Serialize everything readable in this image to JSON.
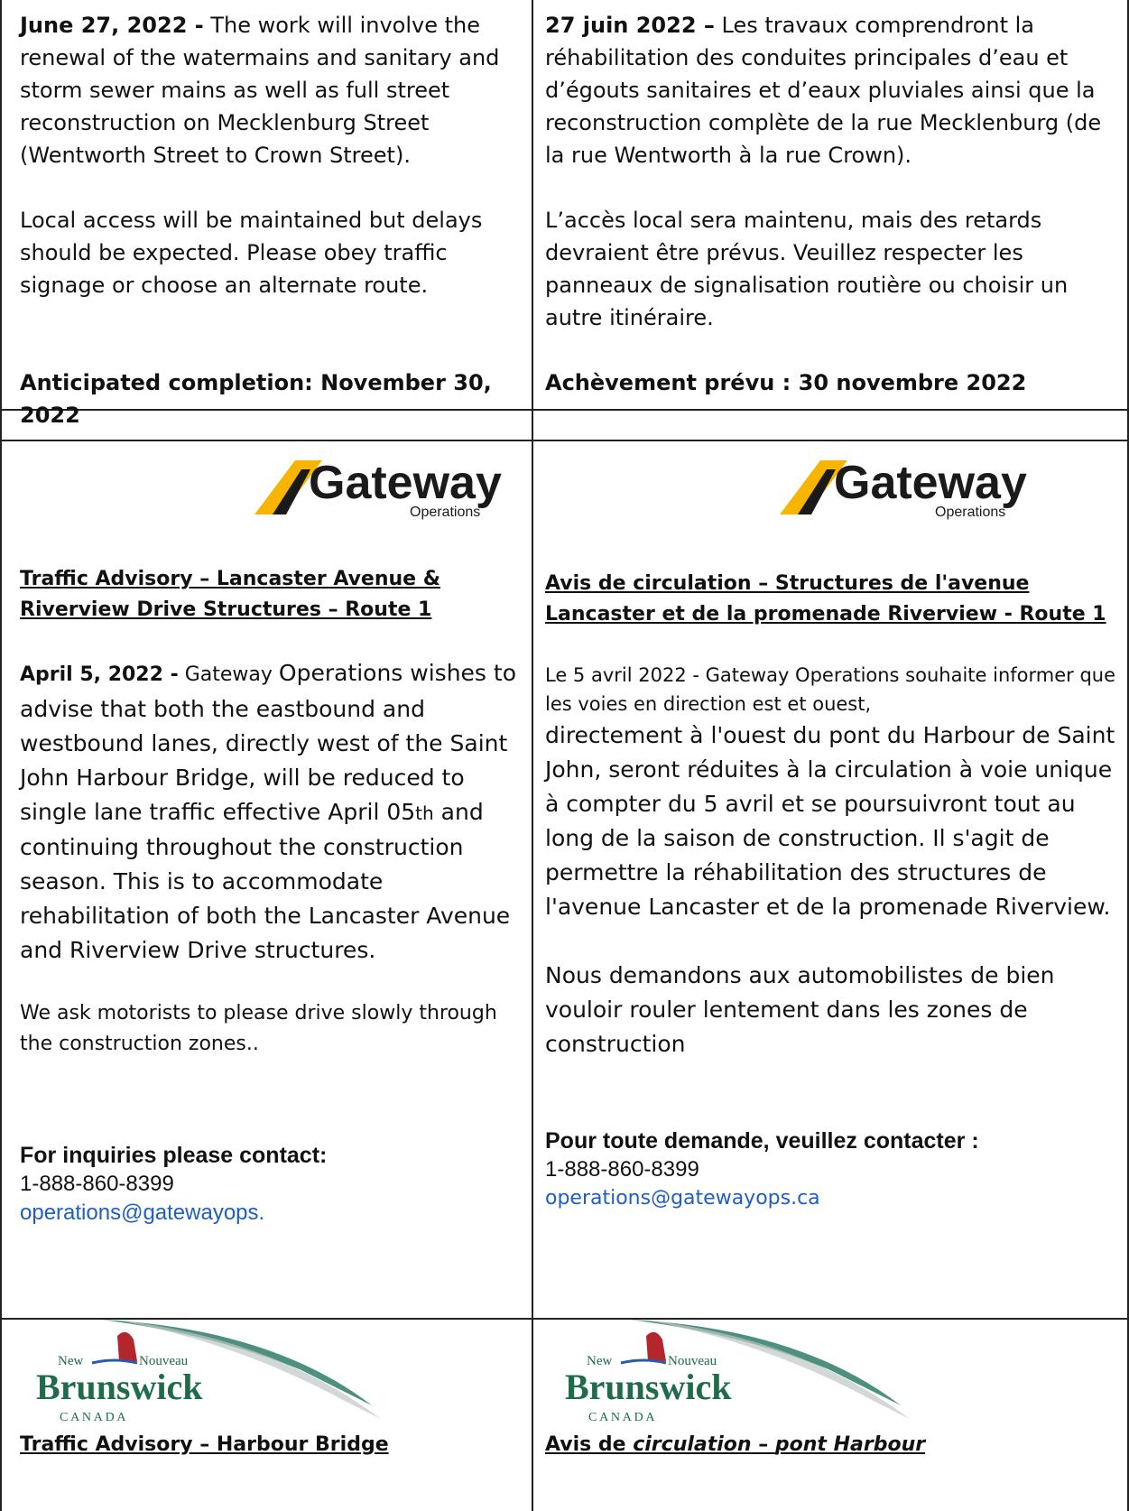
{
  "row1": {
    "en": {
      "date": "June 27, 2022 -",
      "body": " The work will involve the renewal of the watermains and sanitary and storm sewer mains as well as full street reconstruction on Mecklenburg Street (Wentworth Street to Crown Street).",
      "access": "Local access will be maintained but delays should be expected. Please obey traffic signage or choose an alternate route.",
      "completion": "Anticipated completion: November 30, 2022"
    },
    "fr": {
      "date": "27 juin 2022 –",
      "body": " Les travaux comprendront la réhabilitation des conduites principales d’eau et d’égouts sanitaires et d’eaux pluviales ainsi que la reconstruction complète de la rue Mecklenburg (de la rue Wentworth à la rue Crown).",
      "access": "L’accès local sera maintenu, mais des retards devraient être prévus. Veuillez respecter les panneaux de signalisation routière ou choisir un autre itinéraire.",
      "completion": "Achèvement prévu : 30 novembre 2022"
    }
  },
  "gateway_logo": {
    "word": "Gateway",
    "sub": "Operations",
    "colors": {
      "yellow": "#f7b500",
      "black": "#1a1a1a"
    }
  },
  "row3": {
    "en": {
      "title": "Traffic Advisory – Lancaster Avenue & Riverview Drive Structures – Route 1",
      "date": "April 5, 2022 -",
      "lead": " Gateway ",
      "body": "Operations wishes to advise that both the eastbound and westbound lanes, directly west of the Saint John Harbour Bridge, will be reduced to single lane traffic effective April 05",
      "sup": "th",
      "body2": " and continuing throughout the construction season. This is to accommodate rehabilitation of both the Lancaster Avenue and Riverview Drive structures.",
      "ask": "We ask motorists to please drive slowly through the construction zones..",
      "contact_label": "For inquiries please contact:",
      "phone": "1-888-860-8399",
      "email": "operations@gatewayops."
    },
    "fr": {
      "title": "Avis de circulation – Structures de l'avenue Lancaster et de la promenade Riverview - Route 1",
      "lead": "Le 5 avril 2022 -  Gateway Operations souhaite informer que les voies en direction est et ouest,",
      "body": "directement à l'ouest du pont du Harbour de Saint John, seront réduites à la circulation à voie unique à compter du 5 avril et se poursuivront tout au long de la saison de construction. Il s'agit de permettre la réhabilitation des structures de l'avenue Lancaster et de la promenade Riverview.",
      "ask": "Nous demandons aux automobilistes de bien vouloir rouler lentement dans les zones de construction",
      "contact_label": "Pour toute demande, veuillez contacter :",
      "phone": "1-888-860-8399",
      "email": "operations@gatewayops.ca"
    }
  },
  "nb_logo": {
    "new": "New",
    "nouveau": "Nouveau",
    "brunswick": "Brunswick",
    "canada": "C A N A D A",
    "colors": {
      "green": "#1f6b4a",
      "red": "#b3262d",
      "blue": "#2a5aa8",
      "swoosh": "#2f7d6a"
    }
  },
  "row4": {
    "en": {
      "title": "Traffic Advisory – Harbour Bridge"
    },
    "fr": {
      "title_a": "Avis de ",
      "title_b": "circulation",
      "title_c": " – ",
      "title_d": "pont Harbour"
    }
  }
}
